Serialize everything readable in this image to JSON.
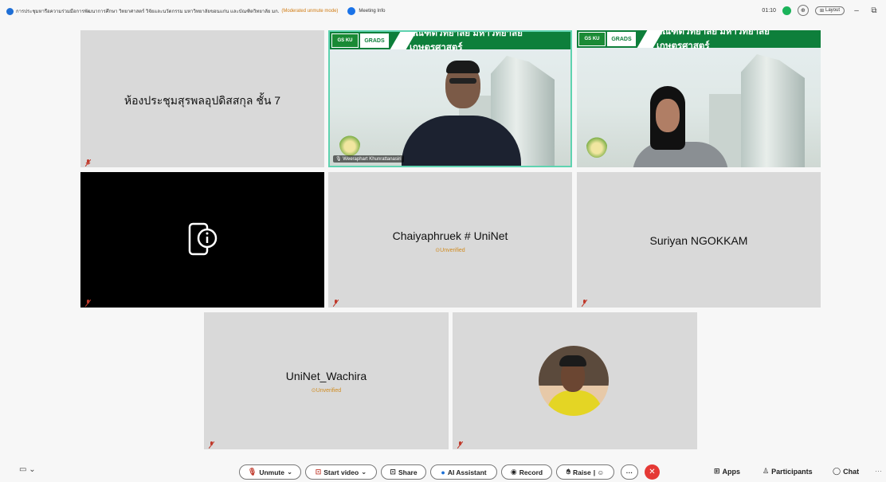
{
  "topbar": {
    "meeting_title": "การประชุมหารือความร่วมมือการพัฒนาการศึกษา วิทยาศาสตร์ วิจัยและนวัตกรรม มหาวิทยาลัยขอนแก่น และบัณฑิตวิทยาลัย มก.",
    "mode": "(Moderated unmute mode)",
    "meeting_info": "Meeting Info",
    "timer": "01:10",
    "layout": "Layout"
  },
  "tiles": {
    "room": {
      "name": "ห้องประชุมสุรพลอุปดิสสกุล ชั้น 7"
    },
    "video1": {
      "banner": "บัณฑิตวิทยาลัย  มหาวิทยาลัยเกษตรศาสตร์",
      "gs": "GS KU",
      "grads": "GRADS",
      "label": "Weeraphart Khunrattanasiri"
    },
    "video2": {
      "banner": "บัณฑิตวิทยาลัย  มหาวิทยาลัยเกษตรศาสตร์",
      "gs": "GS KU",
      "grads": "GRADS"
    },
    "chaiyaphruek": {
      "name": "Chaiyaphruek # UniNet",
      "status": "Unverified"
    },
    "suriyan": {
      "name": "Suriyan NGOKKAM"
    },
    "wachira": {
      "name": "UniNet_Wachira",
      "status": "Unverified"
    }
  },
  "toolbar": {
    "unmute": "Unmute",
    "start_video": "Start video",
    "share": "Share",
    "ai_assistant": "AI Assistant",
    "record": "Record",
    "raise": "Raise",
    "apps": "Apps",
    "participants": "Participants",
    "chat": "Chat"
  },
  "colors": {
    "accent_green": "#0e7f3b",
    "end_red": "#e53935",
    "unverified": "#d08b1f",
    "active_border": "#5fd3b0"
  }
}
